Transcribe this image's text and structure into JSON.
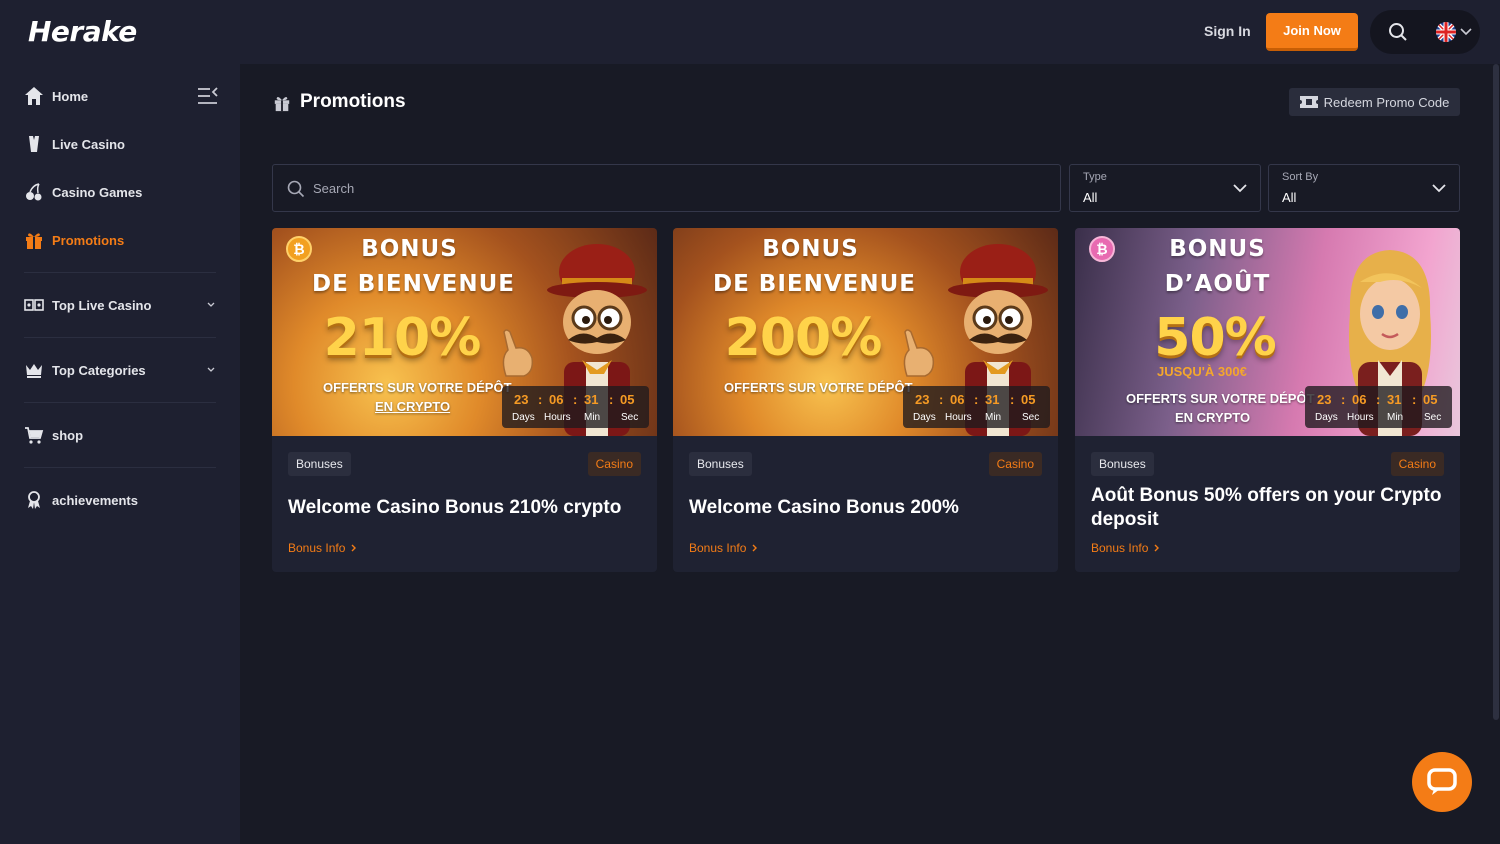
{
  "header": {
    "logo": "Herake",
    "sign_in": "Sign In",
    "join_now": "Join Now"
  },
  "sidebar": {
    "items": [
      {
        "label": "Home",
        "icon": "home-icon"
      },
      {
        "label": "Live Casino",
        "icon": "card-player-icon"
      },
      {
        "label": "Casino Games",
        "icon": "cherries-icon"
      },
      {
        "label": "Promotions",
        "icon": "gift-icon"
      },
      {
        "label": "Top Live Casino",
        "icon": "cards-icon"
      },
      {
        "label": "Top Categories",
        "icon": "crown-icon"
      },
      {
        "label": "shop",
        "icon": "cart-icon"
      },
      {
        "label": "achievements",
        "icon": "medal-icon"
      }
    ]
  },
  "main": {
    "title": "Promotions",
    "redeem": "Redeem Promo Code",
    "search_placeholder": "Search",
    "type": {
      "label": "Type",
      "value": "All"
    },
    "sort": {
      "label": "Sort By",
      "value": "All"
    }
  },
  "cards": [
    {
      "banner": {
        "line1": "BONUS",
        "line2": "DE BIENVENUE",
        "pct": "210%",
        "sub1": "OFFERTS SUR VOTRE DÉPÔT",
        "sub2": "EN CRYPTO",
        "coin": "₿"
      },
      "timer": {
        "days": "23",
        "hours": "06",
        "min": "31",
        "sec": "05",
        "days_lbl": "Days",
        "hours_lbl": "Hours",
        "min_lbl": "Min",
        "sec_lbl": "Sec"
      },
      "tag": "Bonuses",
      "category": "Casino",
      "title": "Welcome Casino Bonus 210% crypto",
      "link": "Bonus Info"
    },
    {
      "banner": {
        "line1": "BONUS",
        "line2": "DE BIENVENUE",
        "pct": "200%",
        "sub1": "OFFERTS SUR VOTRE DÉPÔT"
      },
      "timer": {
        "days": "23",
        "hours": "06",
        "min": "31",
        "sec": "05",
        "days_lbl": "Days",
        "hours_lbl": "Hours",
        "min_lbl": "Min",
        "sec_lbl": "Sec"
      },
      "tag": "Bonuses",
      "category": "Casino",
      "title": "Welcome Casino Bonus 200%",
      "link": "Bonus Info"
    },
    {
      "banner": {
        "line1": "BONUS",
        "line2": "D’AOÛT",
        "pct": "50%",
        "jusqua": "JUSQU'À 300€",
        "sub1": "OFFERTS SUR VOTRE DÉPÔT",
        "sub2": "EN CRYPTO",
        "coin": "₿"
      },
      "timer": {
        "days": "23",
        "hours": "06",
        "min": "31",
        "sec": "05",
        "days_lbl": "Days",
        "hours_lbl": "Hours",
        "min_lbl": "Min",
        "sec_lbl": "Sec"
      },
      "tag": "Bonuses",
      "category": "Casino",
      "title": "Août Bonus 50% offers on your Crypto deposit",
      "link": "Bonus Info"
    }
  ],
  "colors": {
    "accent": "#f47c16",
    "bg": "#181a25",
    "panel": "#1e2030"
  }
}
